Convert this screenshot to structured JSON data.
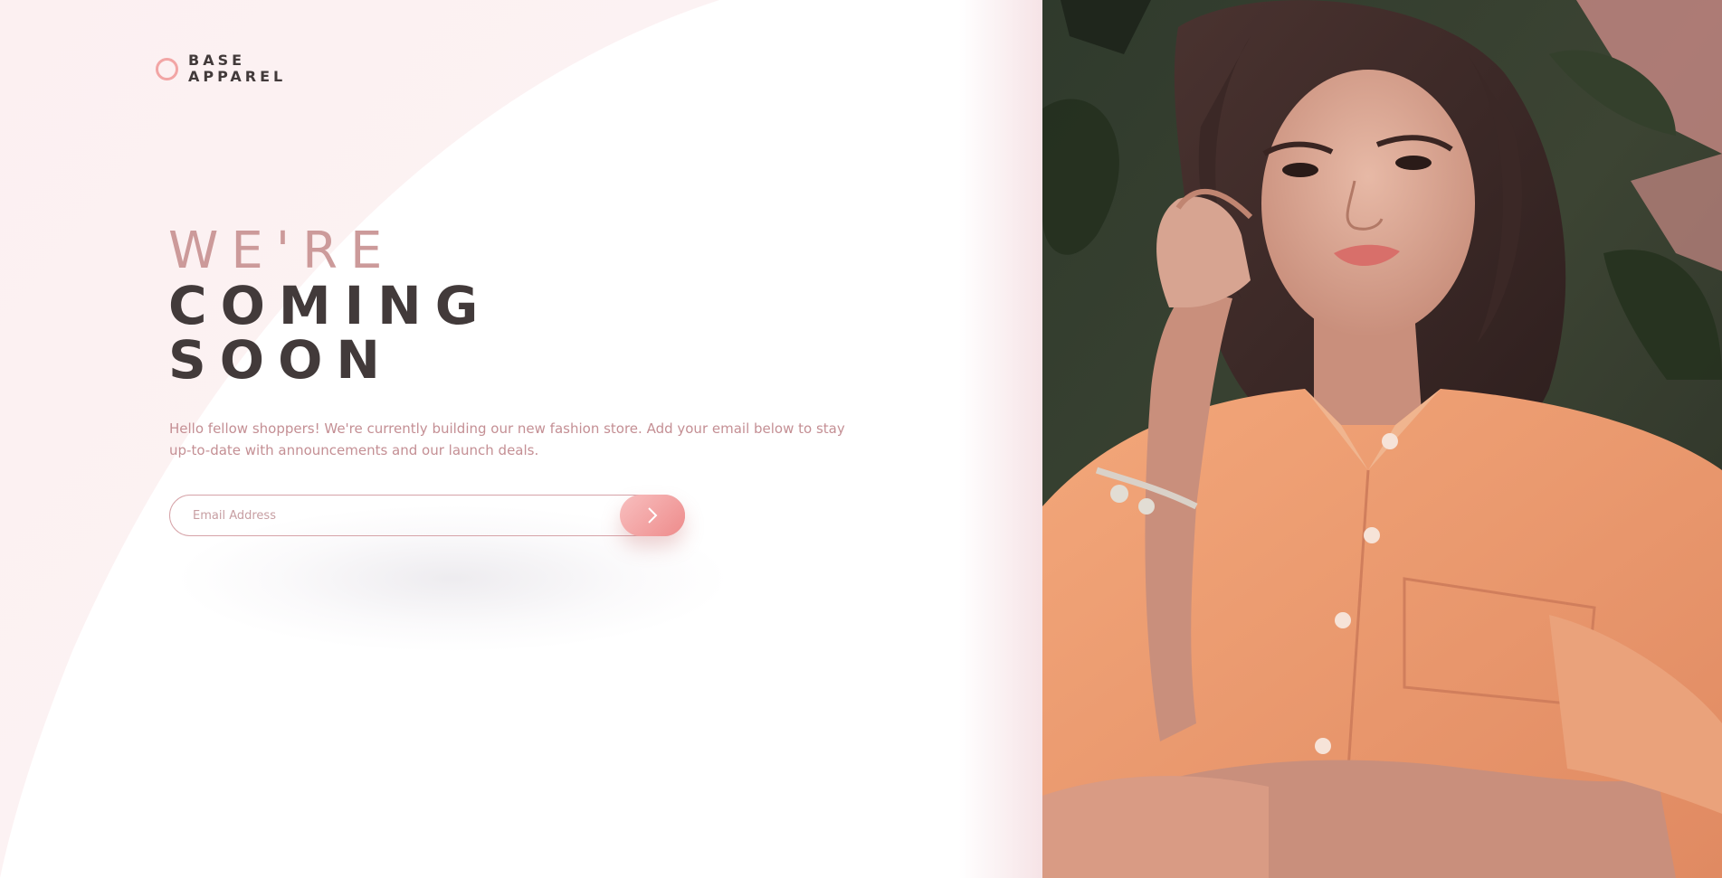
{
  "logo": {
    "line1": "BASE",
    "line2": "APPAREL"
  },
  "headline": {
    "line1": "WE'RE",
    "line2": "COMING",
    "line3": "SOON"
  },
  "description": "Hello fellow shoppers! We're currently building our new fashion store. Add your email below to stay up-to-date with announcements and our launch deals.",
  "form": {
    "email_placeholder": "Email Address",
    "email_value": "",
    "submit_icon": "arrow-right-icon"
  },
  "hero": {
    "subject": "woman in peach shirt against tropical foliage"
  },
  "colors": {
    "accent": "#f2a5a5",
    "text_dark": "#423a3a",
    "text_muted": "#c48f94",
    "headline_light": "#cc9a9a",
    "button_start": "#f8bfbf",
    "button_end": "#ee8b8b"
  }
}
